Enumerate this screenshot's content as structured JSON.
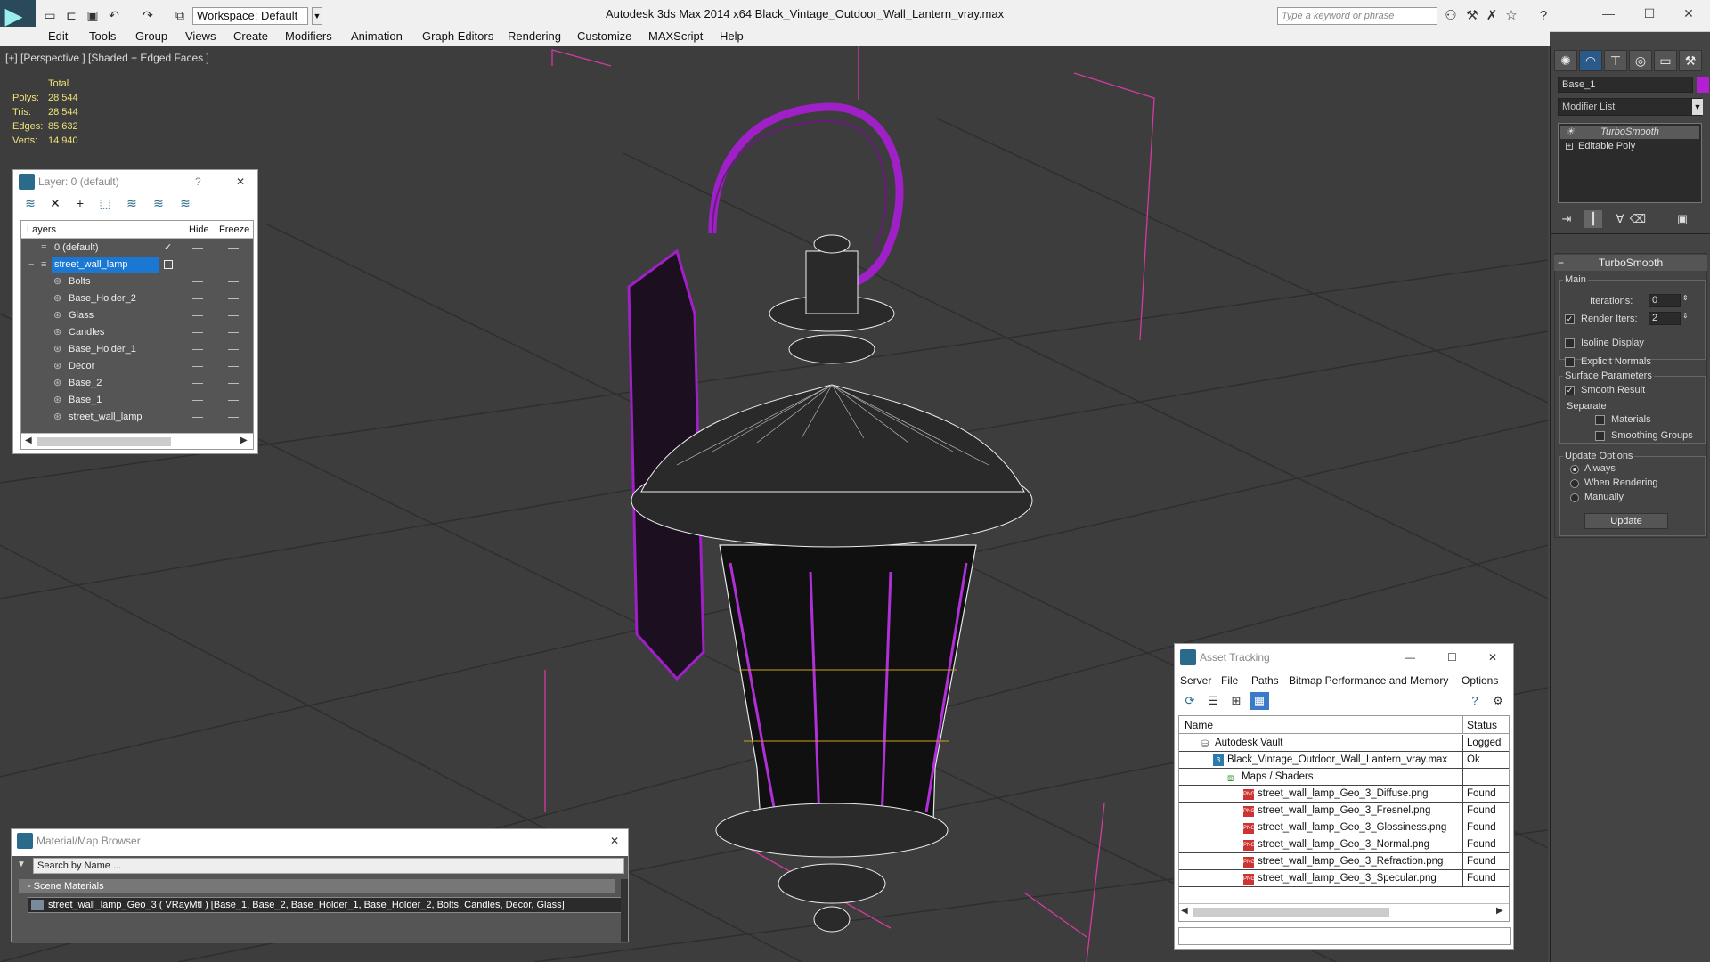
{
  "app": {
    "title": "Autodesk 3ds Max  2014 x64     Black_Vintage_Outdoor_Wall_Lantern_vray.max",
    "workspace": "Workspace: Default",
    "search_placeholder": "Type a keyword or phrase"
  },
  "menu": [
    "Edit",
    "Tools",
    "Group",
    "Views",
    "Create",
    "Modifiers",
    "Animation",
    "Graph Editors",
    "Rendering",
    "Customize",
    "MAXScript",
    "Help"
  ],
  "viewport": {
    "label": "[+] [Perspective ] [Shaded + Edged Faces ]",
    "stats": {
      "header": "Total",
      "rows": [
        {
          "label": "Polys:",
          "value": "28 544"
        },
        {
          "label": "Tris:",
          "value": "28 544"
        },
        {
          "label": "Edges:",
          "value": "85 632"
        },
        {
          "label": "Verts:",
          "value": "14 940"
        }
      ]
    }
  },
  "layer_panel": {
    "title": "Layer: 0 (default)",
    "help": "?",
    "columns": {
      "layers": "Layers",
      "hide": "Hide",
      "freeze": "Freeze"
    },
    "rows": [
      {
        "name": "0 (default)",
        "level": 0
      },
      {
        "name": "street_wall_lamp",
        "level": 0,
        "selected": true
      },
      {
        "name": "Bolts",
        "level": 1
      },
      {
        "name": "Base_Holder_2",
        "level": 1
      },
      {
        "name": "Glass",
        "level": 1
      },
      {
        "name": "Candles",
        "level": 1
      },
      {
        "name": "Base_Holder_1",
        "level": 1
      },
      {
        "name": "Decor",
        "level": 1
      },
      {
        "name": "Base_2",
        "level": 1
      },
      {
        "name": "Base_1",
        "level": 1
      },
      {
        "name": "street_wall_lamp",
        "level": 1
      }
    ]
  },
  "material_browser": {
    "title": "Material/Map Browser",
    "search": "Search by Name ...",
    "section": "- Scene Materials",
    "material": "street_wall_lamp_Geo_3  ( VRayMtl ) [Base_1, Base_2, Base_Holder_1, Base_Holder_2, Bolts, Candles, Decor, Glass]"
  },
  "asset_tracking": {
    "title": "Asset Tracking",
    "menu": [
      "Server",
      "File",
      "Paths",
      "Bitmap Performance and Memory",
      "Options"
    ],
    "columns": {
      "name": "Name",
      "status": "Status"
    },
    "rows": [
      {
        "name": "Autodesk Vault",
        "status": "Logged C",
        "indent": 1
      },
      {
        "name": "Black_Vintage_Outdoor_Wall_Lantern_vray.max",
        "status": "Ok",
        "indent": 2
      },
      {
        "name": "Maps / Shaders",
        "status": "",
        "indent": 3
      },
      {
        "name": "street_wall_lamp_Geo_3_Diffuse.png",
        "status": "Found",
        "indent": 4
      },
      {
        "name": "street_wall_lamp_Geo_3_Fresnel.png",
        "status": "Found",
        "indent": 4
      },
      {
        "name": "street_wall_lamp_Geo_3_Glossiness.png",
        "status": "Found",
        "indent": 4
      },
      {
        "name": "street_wall_lamp_Geo_3_Normal.png",
        "status": "Found",
        "indent": 4
      },
      {
        "name": "street_wall_lamp_Geo_3_Refraction.png",
        "status": "Found",
        "indent": 4
      },
      {
        "name": "street_wall_lamp_Geo_3_Specular.png",
        "status": "Found",
        "indent": 4
      }
    ]
  },
  "command_panel": {
    "object_name": "Base_1",
    "object_color": "#b31fd2",
    "modifier_list": "Modifier List",
    "stack": [
      "TurboSmooth",
      "Editable Poly"
    ],
    "turbosmooth": {
      "title": "TurboSmooth",
      "main": "Main",
      "iterations_label": "Iterations:",
      "iterations": "0",
      "render_iters_label": "Render Iters:",
      "render_iters": "2",
      "isoline": "Isoline Display",
      "explicit_normals": "Explicit Normals",
      "surface_params": "Surface Parameters",
      "smooth_result": "Smooth Result",
      "separate": "Separate",
      "materials": "Materials",
      "smoothing_groups": "Smoothing Groups",
      "update_options": "Update Options",
      "always": "Always",
      "when_rendering": "When Rendering",
      "manually": "Manually",
      "update": "Update"
    }
  },
  "colors": {
    "selection": "#b31fd2",
    "highlight": "#1a77d2",
    "stats": "#f0e27a"
  }
}
